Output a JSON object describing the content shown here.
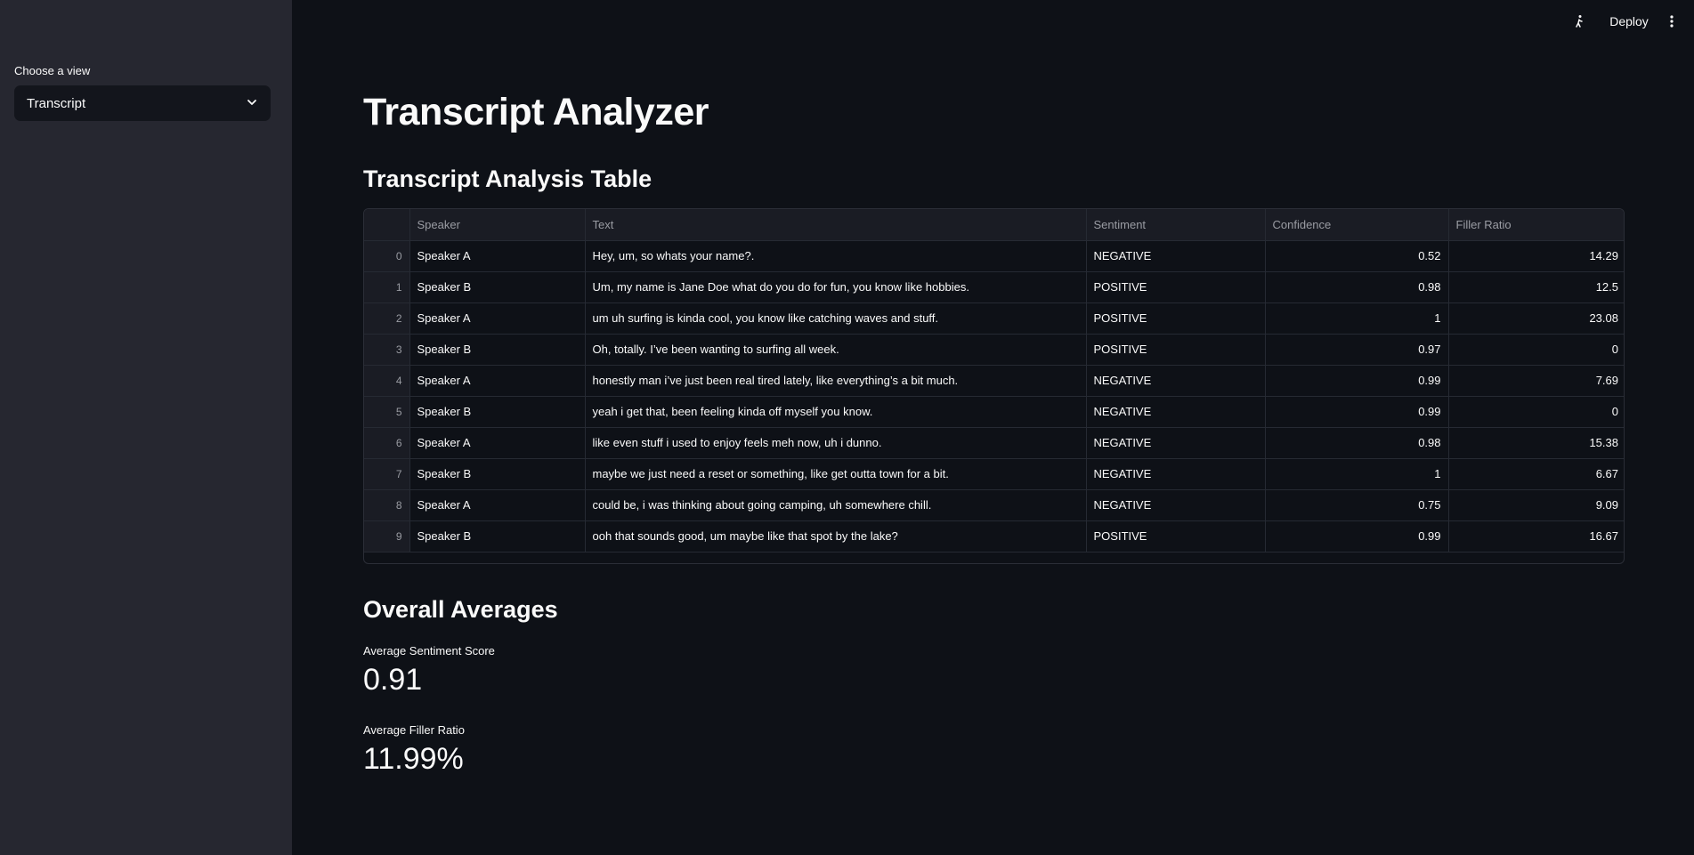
{
  "topbar": {
    "deploy_label": "Deploy"
  },
  "sidebar": {
    "select_label": "Choose a view",
    "select_value": "Transcript"
  },
  "main": {
    "title": "Transcript Analyzer",
    "table_heading": "Transcript Analysis Table",
    "table": {
      "columns": [
        "",
        "Speaker",
        "Text",
        "Sentiment",
        "Confidence",
        "Filler Ratio"
      ],
      "rows": [
        {
          "idx": "0",
          "speaker": "Speaker A",
          "text": "Hey, um, so whats your name?.",
          "sentiment": "NEGATIVE",
          "confidence": "0.52",
          "filler": "14.29"
        },
        {
          "idx": "1",
          "speaker": "Speaker B",
          "text": "Um, my name is Jane Doe what do you do for fun, you know like hobbies.",
          "sentiment": "POSITIVE",
          "confidence": "0.98",
          "filler": "12.5"
        },
        {
          "idx": "2",
          "speaker": "Speaker A",
          "text": "um uh surfing is kinda cool, you know like catching waves and stuff.",
          "sentiment": "POSITIVE",
          "confidence": "1",
          "filler": "23.08"
        },
        {
          "idx": "3",
          "speaker": "Speaker B",
          "text": "Oh, totally. I’ve been wanting to surfing all week.",
          "sentiment": "POSITIVE",
          "confidence": "0.97",
          "filler": "0"
        },
        {
          "idx": "4",
          "speaker": "Speaker A",
          "text": "honestly man i’ve just been real tired lately, like everything’s a bit much.",
          "sentiment": "NEGATIVE",
          "confidence": "0.99",
          "filler": "7.69"
        },
        {
          "idx": "5",
          "speaker": "Speaker B",
          "text": "yeah i get that, been feeling kinda off myself you know.",
          "sentiment": "NEGATIVE",
          "confidence": "0.99",
          "filler": "0"
        },
        {
          "idx": "6",
          "speaker": "Speaker A",
          "text": "like even stuff i used to enjoy feels meh now, uh i dunno.",
          "sentiment": "NEGATIVE",
          "confidence": "0.98",
          "filler": "15.38"
        },
        {
          "idx": "7",
          "speaker": "Speaker B",
          "text": "maybe we just need a reset or something, like get outta town for a bit.",
          "sentiment": "NEGATIVE",
          "confidence": "1",
          "filler": "6.67"
        },
        {
          "idx": "8",
          "speaker": "Speaker A",
          "text": "could be, i was thinking about going camping, uh somewhere chill.",
          "sentiment": "NEGATIVE",
          "confidence": "0.75",
          "filler": "9.09"
        },
        {
          "idx": "9",
          "speaker": "Speaker B",
          "text": "ooh that sounds good, um maybe like that spot by the lake?",
          "sentiment": "POSITIVE",
          "confidence": "0.99",
          "filler": "16.67"
        }
      ]
    },
    "averages_heading": "Overall Averages",
    "metrics": [
      {
        "label": "Average Sentiment Score",
        "value": "0.91"
      },
      {
        "label": "Average Filler Ratio",
        "value": "11.99%"
      }
    ]
  },
  "colors": {
    "background": "#0e1117",
    "sidebar": "#262730",
    "text": "#fafafa",
    "muted": "#9a9ca3"
  }
}
